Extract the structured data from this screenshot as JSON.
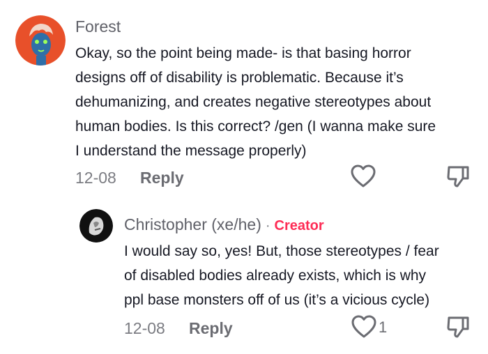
{
  "comments": [
    {
      "username": "Forest",
      "text_lines": [
        "Okay, so the point being made- is that basing horror",
        "designs off of disability is problematic. Because it’s",
        "dehumanizing, and creates negative stereotypes about",
        "human bodies. Is this correct? /gen (I wanna make sure",
        "I understand the message properly)"
      ],
      "date": "12-08",
      "reply_label": "Reply",
      "like_icon": "heart-outline-icon",
      "dislike_icon": "thumbs-down-outline-icon"
    }
  ],
  "replies": [
    {
      "username": "Christopher (xe/he)",
      "separator": "·",
      "badge": "Creator",
      "text_lines": [
        "I would say so, yes! But, those stereotypes / fear",
        "of disabled bodies already exists, which is why",
        "ppl base monsters off of us (it’s a vicious cycle)"
      ],
      "date": "12-08",
      "reply_label": "Reply",
      "like_count": "1",
      "like_icon": "heart-outline-icon",
      "dislike_icon": "thumbs-down-outline-icon"
    }
  ],
  "colors": {
    "creator_badge": "#fe2c55",
    "avatar_forest_bg": "#e8502a",
    "avatar_forest_face": "#2f6fa8",
    "avatar_christopher_bg": "#111111"
  }
}
